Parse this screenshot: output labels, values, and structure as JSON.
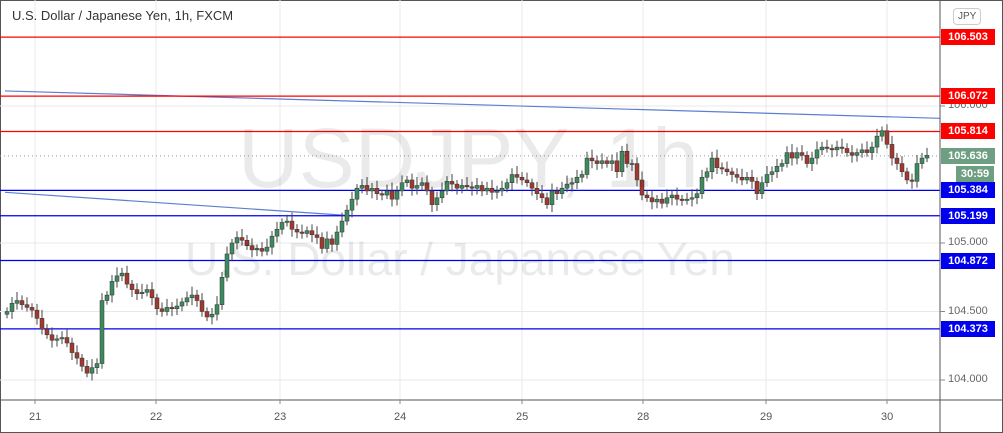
{
  "header": {
    "title": "U.S. Dollar / Japanese Yen, 1h, FXCM",
    "currency_button": "JPY",
    "watermark_symbol": "USDJPY, 1h",
    "watermark_name": "U.S. Dollar / Japanese Yen"
  },
  "colors": {
    "up": "#3d8a5f",
    "down": "#a2392e",
    "resistance": "#ff0000",
    "support": "#0000ee",
    "trend": "#5d7fd1",
    "current": "#6e9f83"
  },
  "chart_data": {
    "type": "candlestick",
    "title": "U.S. Dollar / Japanese Yen, 1h, FXCM",
    "ylim": [
      103.9,
      106.63
    ],
    "y_ticks": [
      {
        "v": 104.0,
        "label": "104.000"
      },
      {
        "v": 104.5,
        "label": "104.500"
      },
      {
        "v": 105.0,
        "label": "105.000"
      },
      {
        "v": 106.0,
        "label": "106.000"
      }
    ],
    "x_ticks": [
      {
        "i": 5.6,
        "label": "21"
      },
      {
        "i": 29.8,
        "label": "22"
      },
      {
        "i": 54.6,
        "label": "23"
      },
      {
        "i": 78.6,
        "label": "24"
      },
      {
        "i": 103,
        "label": "25"
      },
      {
        "i": 127.2,
        "label": "28"
      },
      {
        "i": 151.8,
        "label": "29"
      },
      {
        "i": 176,
        "label": "30"
      }
    ],
    "horizontal_levels": [
      {
        "price": 106.503,
        "label": "106.503",
        "kind": "resistance"
      },
      {
        "price": 106.072,
        "label": "106.072",
        "kind": "resistance"
      },
      {
        "price": 105.814,
        "label": "105.814",
        "kind": "resistance"
      },
      {
        "price": 105.384,
        "label": "105.384",
        "kind": "support"
      },
      {
        "price": 105.199,
        "label": "105.199",
        "kind": "support"
      },
      {
        "price": 104.872,
        "label": "104.872",
        "kind": "support"
      },
      {
        "price": 104.373,
        "label": "104.373",
        "kind": "support"
      }
    ],
    "trendlines": [
      {
        "from": [
          -0.4,
          106.11
        ],
        "to": [
          186.6,
          105.91
        ]
      },
      {
        "from": [
          -0.4,
          105.37
        ],
        "to": [
          68.6,
          105.2
        ]
      }
    ],
    "current_price": {
      "value": 105.636,
      "label": "105.636",
      "countdown": "30:59"
    },
    "first_open": 104.48,
    "closes": [
      104.5,
      104.56,
      104.58,
      104.55,
      104.53,
      104.51,
      104.45,
      104.37,
      104.33,
      104.29,
      104.3,
      104.31,
      104.27,
      104.2,
      104.16,
      104.1,
      104.05,
      104.09,
      104.12,
      104.58,
      104.62,
      104.72,
      104.76,
      104.78,
      104.7,
      104.66,
      104.63,
      104.64,
      104.66,
      104.6,
      104.52,
      104.5,
      104.53,
      104.52,
      104.54,
      104.57,
      104.6,
      104.62,
      104.58,
      104.5,
      104.46,
      104.48,
      104.55,
      104.75,
      104.92,
      105.0,
      105.04,
      105.02,
      104.98,
      104.95,
      104.96,
      104.94,
      104.97,
      105.05,
      105.1,
      105.15,
      105.16,
      105.1,
      105.08,
      105.07,
      105.09,
      105.06,
      105.04,
      104.96,
      105.03,
      104.99,
      105.08,
      105.16,
      105.24,
      105.32,
      105.4,
      105.42,
      105.38,
      105.4,
      105.36,
      105.35,
      105.38,
      105.32,
      105.38,
      105.44,
      105.46,
      105.4,
      105.42,
      105.44,
      105.38,
      105.28,
      105.33,
      105.38,
      105.45,
      105.43,
      105.4,
      105.42,
      105.41,
      105.4,
      105.42,
      105.38,
      105.4,
      105.37,
      105.38,
      105.4,
      105.44,
      105.5,
      105.48,
      105.46,
      105.44,
      105.4,
      105.36,
      105.33,
      105.28,
      105.38,
      105.36,
      105.4,
      105.43,
      105.44,
      105.48,
      105.5,
      105.62,
      105.6,
      105.58,
      105.6,
      105.58,
      105.6,
      105.52,
      105.67,
      105.58,
      105.58,
      105.46,
      105.35,
      105.33,
      105.3,
      105.32,
      105.29,
      105.33,
      105.35,
      105.32,
      105.31,
      105.32,
      105.33,
      105.36,
      105.48,
      105.52,
      105.62,
      105.55,
      105.54,
      105.52,
      105.5,
      105.48,
      105.46,
      105.48,
      105.45,
      105.36,
      105.44,
      105.5,
      105.52,
      105.56,
      105.58,
      105.66,
      105.62,
      105.66,
      105.64,
      105.58,
      105.62,
      105.68,
      105.7,
      105.69,
      105.68,
      105.7,
      105.69,
      105.66,
      105.64,
      105.66,
      105.68,
      105.66,
      105.7,
      105.78,
      105.82,
      105.72,
      105.62,
      105.58,
      105.52,
      105.46,
      105.45,
      105.58,
      105.62,
      105.64
    ]
  }
}
